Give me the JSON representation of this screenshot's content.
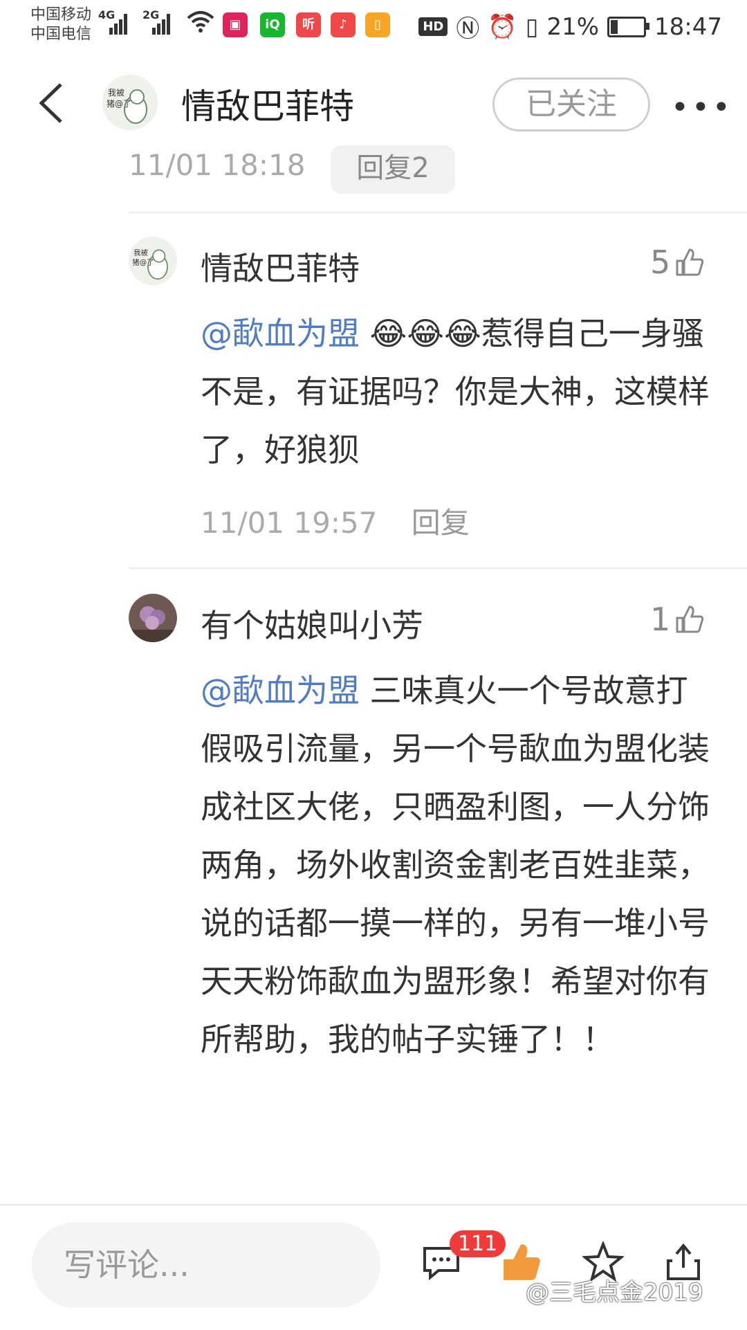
{
  "status": {
    "carrier1": "中国移动",
    "carrier2": "中国电信",
    "net1": "4G",
    "net2": "2G",
    "battery_pct": "21%",
    "time": "18:47",
    "hd": "HD",
    "app_icons": [
      {
        "name": "weibo-app-icon",
        "color": "#e0235a"
      },
      {
        "name": "iqiyi-app-icon",
        "color": "#18b82e"
      },
      {
        "name": "ting-app-icon",
        "color": "#f04848"
      },
      {
        "name": "music-app-icon",
        "color": "#f04848"
      },
      {
        "name": "orange-app-icon",
        "color": "#f7a623"
      }
    ]
  },
  "header": {
    "title": "情敌巴菲特",
    "follow_label": "已关注",
    "more_label": "•••"
  },
  "prev_comment": {
    "timestamp": "11/01 18:18",
    "reply_label": "回复2"
  },
  "comments": [
    {
      "author": "情敌巴菲特",
      "likes": "5",
      "mention": "@歃血为盟",
      "emoji": "😂😂😂",
      "text": "惹得自己一身骚不是，有证据吗？你是大神，这模样了，好狼狈",
      "timestamp": "11/01 19:57",
      "reply_label": "回复"
    },
    {
      "author": "有个姑娘叫小芳",
      "likes": "1",
      "mention": "@歃血为盟",
      "text": "三味真火一个号故意打假吸引流量，另一个号歃血为盟化装成社区大佬，只晒盈利图，一人分饰两角，场外收割资金割老百姓韭菜，说的话都一摸一样的，另有一堆小号天天粉饰歃血为盟形象！希望对你有所帮助，我的帖子实锤了！！"
    }
  ],
  "bottom": {
    "input_placeholder": "写评论...",
    "comment_count": "111",
    "watermark": "@三毛点金2019"
  },
  "colors": {
    "mention": "#4f7cc2",
    "badge": "#f03b3b",
    "like_orange": "#f29a3b"
  }
}
